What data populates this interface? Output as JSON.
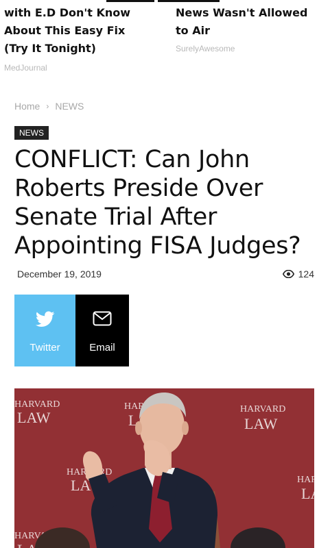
{
  "ads": [
    {
      "title_lines": [
        "with E.D Don't Know",
        "About This Easy Fix",
        "(Try It Tonight)"
      ],
      "source": "MedJournal"
    },
    {
      "title_lines": [
        "News Wasn't Allowed",
        "to Air"
      ],
      "source": "SurelyAwesome"
    }
  ],
  "breadcrumb": {
    "home": "Home",
    "separator": "›",
    "section": "NEWS"
  },
  "article": {
    "category_badge": "NEWS",
    "headline_lines": [
      "CONFLICT: Can John",
      "Roberts Preside Over",
      "Senate Trial After",
      "Appointing FISA Judges?"
    ],
    "date": "December 19, 2019",
    "views": "124"
  },
  "share": {
    "twitter_label": "Twitter",
    "email_label": "Email",
    "colors": {
      "twitter": "#5ec1f2",
      "email": "#000000"
    }
  },
  "photo": {
    "icon": "image",
    "watermarks": [
      {
        "line1": "HARVARD",
        "line2": "LAW"
      },
      {
        "line1": "HARVARD",
        "line2": "LAW"
      },
      {
        "line1": "HARVARD",
        "line2": "LAW"
      },
      {
        "line1": "HARVARD",
        "line2": "LAW"
      },
      {
        "line1": "HARVARD",
        "line2": "LAW"
      },
      {
        "line1": "HARVARD",
        "line2": "LAW"
      }
    ]
  }
}
